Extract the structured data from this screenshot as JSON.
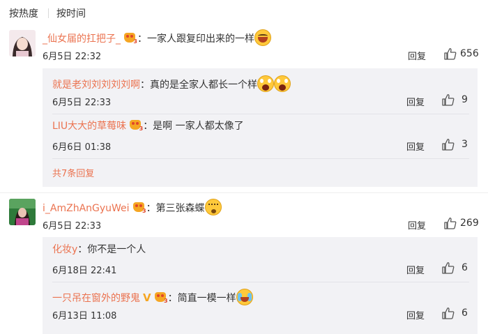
{
  "sort": {
    "hot_label": "按热度",
    "time_label": "按时间"
  },
  "comments": [
    {
      "author": "_仙女届的扛把子_",
      "has_vip": true,
      "text": "：一家人跟复印出来的一样",
      "emoji": "laughing-tears",
      "time": "6月5日 22:32",
      "reply_label": "回复",
      "likes": "656",
      "replies": [
        {
          "author": "就是老刘刘刘刘刘啊",
          "has_vip": false,
          "text": "：真的是全家人都长一个样",
          "emoji": "shocked-face",
          "time": "6月5日 22:33",
          "reply_label": "回复",
          "likes": "9"
        },
        {
          "author": "LIU大大的草莓味",
          "has_vip": true,
          "text": "：是啊 一家人都太像了",
          "emoji": "",
          "time": "6月6日 01:38",
          "reply_label": "回复",
          "likes": "3"
        }
      ],
      "more_label": "共7条回复"
    },
    {
      "author": "i_AmZhAnGyuWei",
      "has_vip": true,
      "text": "：第三张森蝶",
      "emoji": "dizzy-face",
      "time": "6月5日 22:33",
      "reply_label": "回复",
      "likes": "269",
      "replies": [
        {
          "author": "化妆y",
          "has_vip": false,
          "text": "：你不是一个人",
          "emoji": "",
          "time": "6月18日 22:41",
          "reply_label": "回复",
          "likes": "6"
        },
        {
          "author": "一只吊在窗外的野鬼",
          "has_vip": true,
          "verified_mark": "V",
          "text": "：简直一模一样",
          "emoji": "crying-laughing",
          "time": "6月13日 11:08",
          "reply_label": "回复",
          "likes": "6"
        }
      ]
    }
  ],
  "colors": {
    "username": "#eb7350",
    "sub_background": "#f2f2f5",
    "text": "#333333"
  }
}
